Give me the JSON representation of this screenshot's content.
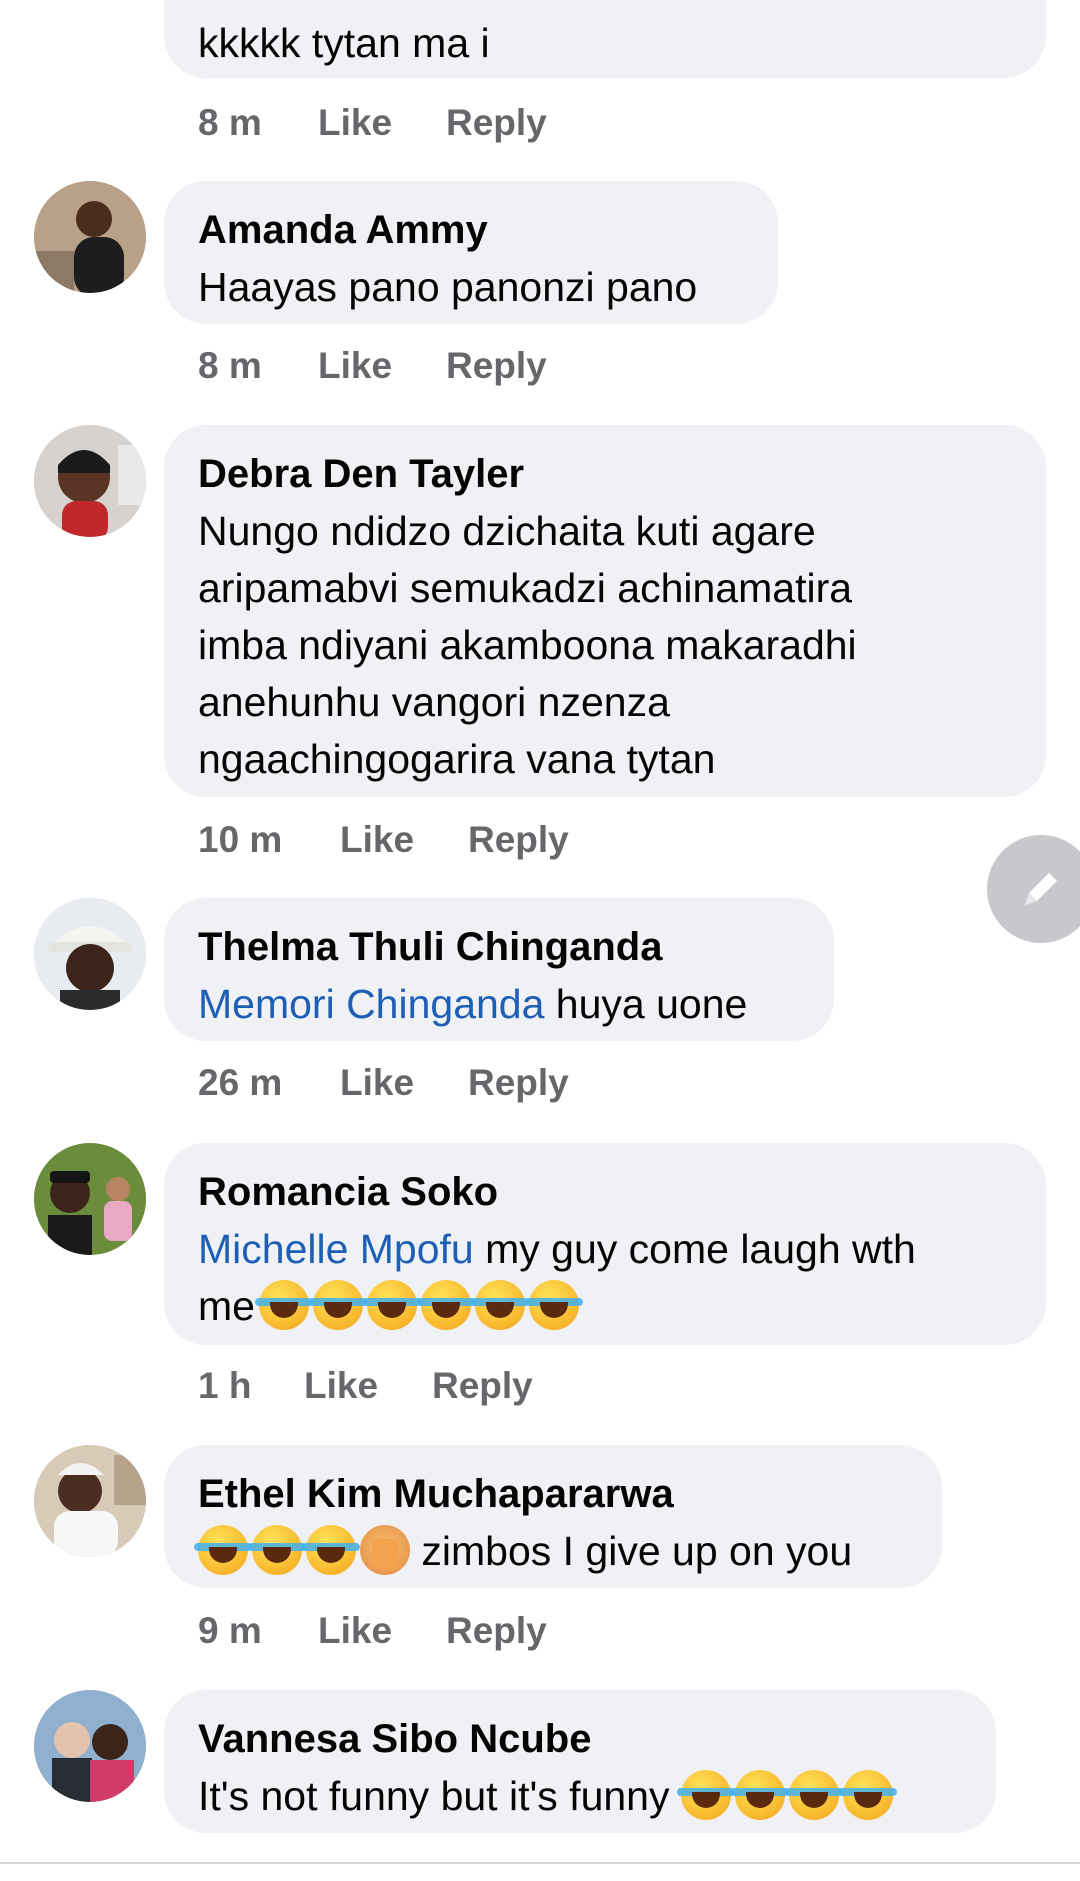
{
  "comments": [
    {
      "text": "kkkkk tytan ma i",
      "time": "8 m",
      "like": "Like",
      "reply": "Reply"
    },
    {
      "name": "Amanda Ammy",
      "text": "Haayas pano panonzi pano",
      "time": "8 m",
      "like": "Like",
      "reply": "Reply"
    },
    {
      "name": "Debra Den Tayler",
      "lines": [
        "Nungo ndidzo dzichaita kuti agare",
        "aripamabvi semukadzi achinamatira",
        "imba ndiyani akamboona makaradhi",
        "anehunhu vangori nzenza",
        "ngaachingogarira vana tytan"
      ],
      "time": "10 m",
      "like": "Like",
      "reply": "Reply"
    },
    {
      "name": "Thelma Thuli Chinganda",
      "mention": "Memori Chinganda",
      "text": " huya uone",
      "time": "26 m",
      "like": "Like",
      "reply": "Reply"
    },
    {
      "name": "Romancia Soko",
      "mention": "Michelle Mpofu",
      "text": " my guy come laugh wth",
      "text2": "me",
      "emojis": [
        "rofl-emoji",
        "rofl-emoji",
        "rofl-emoji",
        "rofl-emoji",
        "rofl-emoji",
        "rofl-emoji"
      ],
      "time": "1 h",
      "like": "Like",
      "reply": "Reply"
    },
    {
      "name": "Ethel Kim Muchapararwa",
      "emojis": [
        "joy-emoji",
        "joy-emoji",
        "joy-emoji",
        "facepalm-emoji"
      ],
      "text": " zimbos I give up on you",
      "time": "9 m",
      "like": "Like",
      "reply": "Reply"
    },
    {
      "name": "Vannesa Sibo Ncube",
      "text": "It's not funny but it's funny",
      "emojis": [
        "joy-emoji",
        "joy-emoji",
        "joy-emoji",
        "joy-emoji"
      ]
    }
  ],
  "fab_icon": "pencil-icon",
  "colors": {
    "bubble": "#f0f1f4",
    "mention": "#1e5fb6",
    "meta": "#65676b",
    "fab": "#c7c8cc"
  }
}
